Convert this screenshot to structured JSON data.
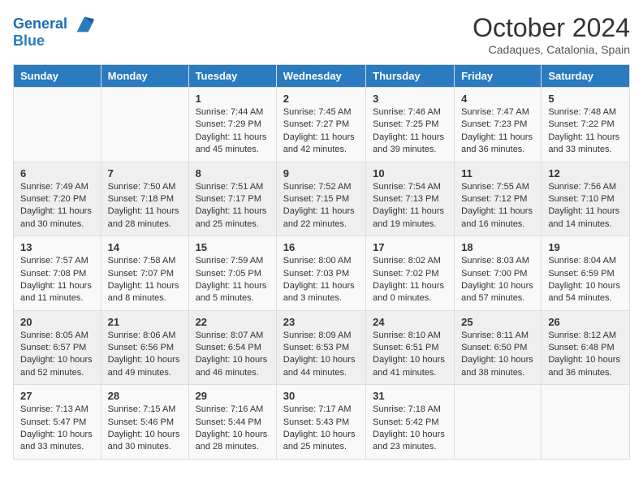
{
  "header": {
    "logo_line1": "General",
    "logo_line2": "Blue",
    "month": "October 2024",
    "location": "Cadaques, Catalonia, Spain"
  },
  "days_of_week": [
    "Sunday",
    "Monday",
    "Tuesday",
    "Wednesday",
    "Thursday",
    "Friday",
    "Saturday"
  ],
  "weeks": [
    [
      {
        "day": "",
        "info": ""
      },
      {
        "day": "",
        "info": ""
      },
      {
        "day": "1",
        "info": "Sunrise: 7:44 AM\nSunset: 7:29 PM\nDaylight: 11 hours and 45 minutes."
      },
      {
        "day": "2",
        "info": "Sunrise: 7:45 AM\nSunset: 7:27 PM\nDaylight: 11 hours and 42 minutes."
      },
      {
        "day": "3",
        "info": "Sunrise: 7:46 AM\nSunset: 7:25 PM\nDaylight: 11 hours and 39 minutes."
      },
      {
        "day": "4",
        "info": "Sunrise: 7:47 AM\nSunset: 7:23 PM\nDaylight: 11 hours and 36 minutes."
      },
      {
        "day": "5",
        "info": "Sunrise: 7:48 AM\nSunset: 7:22 PM\nDaylight: 11 hours and 33 minutes."
      }
    ],
    [
      {
        "day": "6",
        "info": "Sunrise: 7:49 AM\nSunset: 7:20 PM\nDaylight: 11 hours and 30 minutes."
      },
      {
        "day": "7",
        "info": "Sunrise: 7:50 AM\nSunset: 7:18 PM\nDaylight: 11 hours and 28 minutes."
      },
      {
        "day": "8",
        "info": "Sunrise: 7:51 AM\nSunset: 7:17 PM\nDaylight: 11 hours and 25 minutes."
      },
      {
        "day": "9",
        "info": "Sunrise: 7:52 AM\nSunset: 7:15 PM\nDaylight: 11 hours and 22 minutes."
      },
      {
        "day": "10",
        "info": "Sunrise: 7:54 AM\nSunset: 7:13 PM\nDaylight: 11 hours and 19 minutes."
      },
      {
        "day": "11",
        "info": "Sunrise: 7:55 AM\nSunset: 7:12 PM\nDaylight: 11 hours and 16 minutes."
      },
      {
        "day": "12",
        "info": "Sunrise: 7:56 AM\nSunset: 7:10 PM\nDaylight: 11 hours and 14 minutes."
      }
    ],
    [
      {
        "day": "13",
        "info": "Sunrise: 7:57 AM\nSunset: 7:08 PM\nDaylight: 11 hours and 11 minutes."
      },
      {
        "day": "14",
        "info": "Sunrise: 7:58 AM\nSunset: 7:07 PM\nDaylight: 11 hours and 8 minutes."
      },
      {
        "day": "15",
        "info": "Sunrise: 7:59 AM\nSunset: 7:05 PM\nDaylight: 11 hours and 5 minutes."
      },
      {
        "day": "16",
        "info": "Sunrise: 8:00 AM\nSunset: 7:03 PM\nDaylight: 11 hours and 3 minutes."
      },
      {
        "day": "17",
        "info": "Sunrise: 8:02 AM\nSunset: 7:02 PM\nDaylight: 11 hours and 0 minutes."
      },
      {
        "day": "18",
        "info": "Sunrise: 8:03 AM\nSunset: 7:00 PM\nDaylight: 10 hours and 57 minutes."
      },
      {
        "day": "19",
        "info": "Sunrise: 8:04 AM\nSunset: 6:59 PM\nDaylight: 10 hours and 54 minutes."
      }
    ],
    [
      {
        "day": "20",
        "info": "Sunrise: 8:05 AM\nSunset: 6:57 PM\nDaylight: 10 hours and 52 minutes."
      },
      {
        "day": "21",
        "info": "Sunrise: 8:06 AM\nSunset: 6:56 PM\nDaylight: 10 hours and 49 minutes."
      },
      {
        "day": "22",
        "info": "Sunrise: 8:07 AM\nSunset: 6:54 PM\nDaylight: 10 hours and 46 minutes."
      },
      {
        "day": "23",
        "info": "Sunrise: 8:09 AM\nSunset: 6:53 PM\nDaylight: 10 hours and 44 minutes."
      },
      {
        "day": "24",
        "info": "Sunrise: 8:10 AM\nSunset: 6:51 PM\nDaylight: 10 hours and 41 minutes."
      },
      {
        "day": "25",
        "info": "Sunrise: 8:11 AM\nSunset: 6:50 PM\nDaylight: 10 hours and 38 minutes."
      },
      {
        "day": "26",
        "info": "Sunrise: 8:12 AM\nSunset: 6:48 PM\nDaylight: 10 hours and 36 minutes."
      }
    ],
    [
      {
        "day": "27",
        "info": "Sunrise: 7:13 AM\nSunset: 5:47 PM\nDaylight: 10 hours and 33 minutes."
      },
      {
        "day": "28",
        "info": "Sunrise: 7:15 AM\nSunset: 5:46 PM\nDaylight: 10 hours and 30 minutes."
      },
      {
        "day": "29",
        "info": "Sunrise: 7:16 AM\nSunset: 5:44 PM\nDaylight: 10 hours and 28 minutes."
      },
      {
        "day": "30",
        "info": "Sunrise: 7:17 AM\nSunset: 5:43 PM\nDaylight: 10 hours and 25 minutes."
      },
      {
        "day": "31",
        "info": "Sunrise: 7:18 AM\nSunset: 5:42 PM\nDaylight: 10 hours and 23 minutes."
      },
      {
        "day": "",
        "info": ""
      },
      {
        "day": "",
        "info": ""
      }
    ]
  ]
}
